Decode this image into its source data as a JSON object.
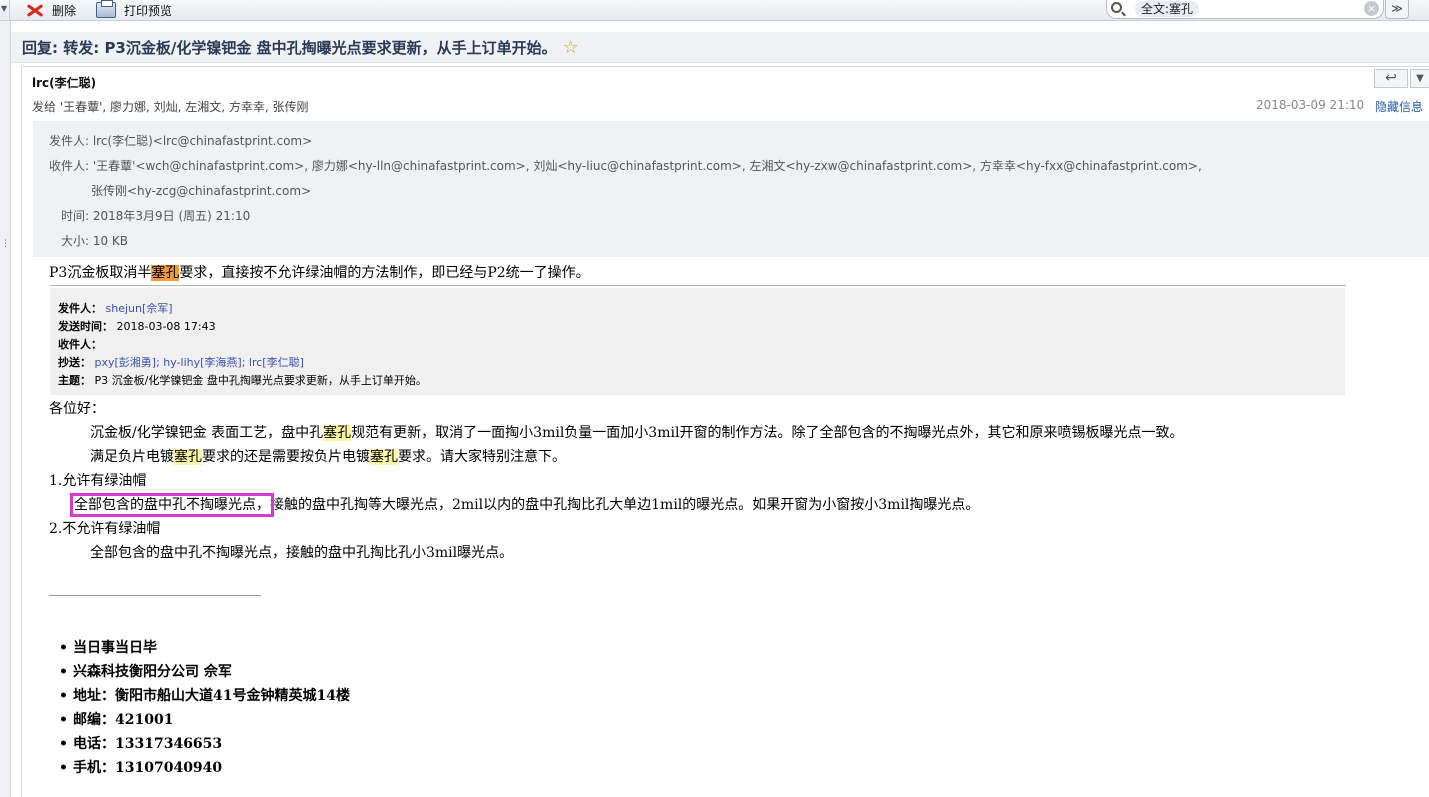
{
  "toolbar": {
    "delete_label": "删除",
    "print_preview_label": "打印预览",
    "search_tag": "全文:塞孔"
  },
  "subject": "回复: 转发: P3沉金板/化学镍钯金 盘中孔掏曝光点要求更新，从手上订单开始。",
  "message": {
    "sender_display": "lrc(李仁聪)",
    "send_to_line": "发给 '王春蕈', 廖力娜, 刘灿, 左湘文, 方幸幸, 张传刚",
    "date": "2018-03-09 21:10",
    "hide_info_label": "隐藏信息",
    "headers": {
      "from_label": "发件人:",
      "from_value": "lrc(李仁聪)<lrc@chinafastprint.com>",
      "to_label": "收件人:",
      "to_value_line1": "'王春蕈'<wch@chinafastprint.com>, 廖力娜<hy-lln@chinafastprint.com>, 刘灿<hy-liuc@chinafastprint.com>, 左湘文<hy-zxw@chinafastprint.com>, 方幸幸<hy-fxx@chinafastprint.com>,",
      "to_value_line2": "张传刚<hy-zcg@chinafastprint.com>",
      "time_label": "时间:",
      "time_value": "2018年3月9日 (周五) 21:10",
      "size_label": "大小:",
      "size_value": "10 KB"
    }
  },
  "body": {
    "intro_pre": "P3沉金板取消半",
    "intro_hl": "塞孔",
    "intro_post": "要求，直接按不允许绿油帽的方法制作，即已经与P2统一了操作。",
    "quote": {
      "from_label": "发件人：",
      "from_value": "shejun[佘军]",
      "sent_label": "发送时间：",
      "sent_value": "2018-03-08 17:43",
      "to_label": "收件人：",
      "cc_label": "抄送：",
      "cc_value": "pxy[彭湘勇]; hy-lihy[李海燕]; lrc[李仁聪]",
      "subject_label": "主题：",
      "subject_value": "P3 沉金板/化学镍钯金 盘中孔掏曝光点要求更新，从手上订单开始。"
    },
    "greeting": "各位好：",
    "para1_a": "沉金板/化学镍钯金 表面工艺，盘中孔",
    "para1_hl": "塞孔",
    "para1_b": "规范有更新，取消了一面掏小3mil负量一面加小3mil开窗的制作方法。除了全部包含的不掏曝光点外，其它和原来喷锡板曝光点一致。",
    "para2_a": "满足负片电镀",
    "para2_hl1": "塞孔",
    "para2_b": "要求的还是需要按负片电镀",
    "para2_hl2": "塞孔",
    "para2_c": "要求。请大家特别注意下。",
    "item1_title": "1.允许有绿油帽",
    "item1_boxed": "全部包含的盘中孔不掏曝光点，",
    "item1_rest": "接触的盘中孔掏等大曝光点，2mil以内的盘中孔掏比孔大单边1mil的曝光点。如果开窗为小窗按小3mil掏曝光点。",
    "item2_title": "2.不允许有绿油帽",
    "item2_text": "全部包含的盘中孔不掏曝光点，接触的盘中孔掏比孔小3mil曝光点。",
    "signature": [
      "当日事当日毕",
      "兴森科技衡阳分公司 佘军",
      "地址：衡阳市船山大道41号金钟精英城14楼",
      "邮编：421001",
      "电话：13317346653",
      "手机：13107040940"
    ]
  }
}
